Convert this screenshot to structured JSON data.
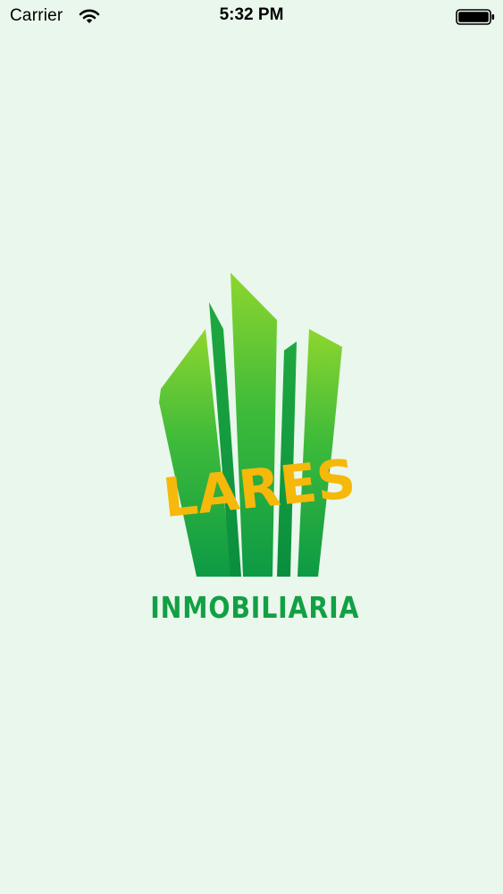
{
  "status_bar": {
    "carrier": "Carrier",
    "time": "5:32 PM",
    "wifi_icon": "wifi-icon",
    "battery_icon": "battery-full-icon"
  },
  "splash": {
    "logo_word": "LARES",
    "subtitle": "INMOBILIARIA",
    "colors": {
      "background": "#eaf7ec",
      "green_light": "#8ed62e",
      "green_dark": "#0c9a45",
      "yellow": "#f6b80a",
      "subtitle": "#12a044"
    }
  }
}
